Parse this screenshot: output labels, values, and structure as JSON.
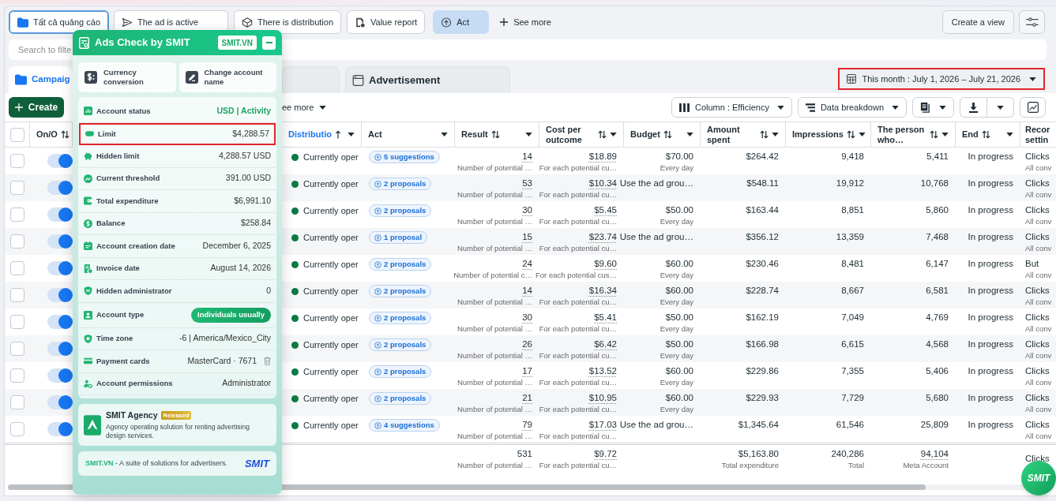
{
  "filter_chips": [
    {
      "label": "Tất cả quảng cáo",
      "selected": true,
      "pressed": false
    },
    {
      "label": "The ad is active",
      "selected": false,
      "pressed": false
    },
    {
      "label": "There is distribution",
      "selected": false,
      "pressed": false
    },
    {
      "label": "Value report",
      "selected": false,
      "pressed": false
    },
    {
      "label": "Act",
      "selected": false,
      "pressed": true
    }
  ],
  "see_more": "See more",
  "create_view": "Create a view",
  "search": {
    "placeholder": "Search to filte"
  },
  "level_tabs": [
    {
      "label": "Campaig",
      "selected": true
    },
    {
      "selected": false
    },
    {
      "label": "Advertisement",
      "selected": false
    }
  ],
  "date_range": {
    "label": "This month : July 1, 2026 – July 21, 2026",
    "highlighted": true
  },
  "toolbar": {
    "create": "Create",
    "more": "ee more",
    "columns": "Column : Efficiency",
    "breakdown": "Data breakdown"
  },
  "table": {
    "select_all": {
      "checked": false
    },
    "columns": [
      {
        "label": "On/O",
        "sortable": true,
        "sorted": false,
        "menu": false
      },
      {
        "label": "Distributio",
        "sortable": true,
        "sorted": true,
        "menu": true
      },
      {
        "label": "Act",
        "sortable": false,
        "sorted": false,
        "menu": true
      },
      {
        "label": "Result",
        "sortable": true,
        "sorted": false,
        "menu": true
      },
      {
        "label": "Cost per outcome",
        "sortable": true,
        "sorted": false,
        "menu": true
      },
      {
        "label": "Budget",
        "sortable": true,
        "sorted": false,
        "menu": true
      },
      {
        "label": "Amount spent",
        "sortable": true,
        "sorted": false,
        "menu": true
      },
      {
        "label": "Impressions",
        "sortable": true,
        "sorted": false,
        "menu": true
      },
      {
        "label": "The person who…",
        "sortable": true,
        "sorted": false,
        "menu": true
      },
      {
        "label": "End",
        "sortable": true,
        "sorted": false,
        "menu": true
      },
      {
        "label": "Recor settin",
        "sortable": false,
        "sorted": false,
        "menu": false
      }
    ],
    "rows": [
      {
        "checked": false,
        "on": true,
        "status": "Currently oper",
        "act": "5 suggestions",
        "result": "14",
        "result_note": "Number of potential …",
        "cost": "$18.89",
        "cost_note": "For each potential cu…",
        "budget": "$70.00",
        "budget_note": "Every day",
        "amount": "$264.42",
        "impressions": "9,418",
        "people": "5,411",
        "end": "In progress",
        "record": "Clicks",
        "record_note": "All conv"
      },
      {
        "checked": false,
        "on": true,
        "status": "Currently oper",
        "act": "2 proposals",
        "result": "53",
        "result_note": "Number of potential …",
        "cost": "$10.34",
        "cost_note": "For each potential cu…",
        "budget": "Use the ad grou…",
        "amount": "$548.11",
        "impressions": "19,912",
        "people": "10,768",
        "end": "In progress",
        "record": "Clicks",
        "record_note": "All conv"
      },
      {
        "checked": false,
        "on": true,
        "status": "Currently oper",
        "act": "2 proposals",
        "result": "30",
        "result_note": "Number of potential …",
        "cost": "$5.45",
        "cost_note": "For each potential cu…",
        "budget": "$50.00",
        "budget_note": "Every day",
        "amount": "$163.44",
        "impressions": "8,851",
        "people": "5,860",
        "end": "In progress",
        "record": "Clicks",
        "record_note": "All conv"
      },
      {
        "checked": false,
        "on": true,
        "status": "Currently oper",
        "act": "1 proposal",
        "result": "15",
        "result_note": "Number of potential …",
        "cost": "$23.74",
        "cost_note": "For each potential cu…",
        "budget": "Use the ad grou…",
        "amount": "$356.12",
        "impressions": "13,359",
        "people": "7,468",
        "end": "In progress",
        "record": "Clicks",
        "record_note": "All conv"
      },
      {
        "checked": false,
        "on": true,
        "status": "Currently oper",
        "act": "2 proposals",
        "result": "24",
        "result_note": "Number of potential c…",
        "cost": "$9.60",
        "cost_note": "For each potential cus…",
        "budget": "$60.00",
        "budget_note": "Every day",
        "amount": "$230.46",
        "impressions": "8,481",
        "people": "6,147",
        "end": "In progress",
        "record": "But",
        "record_note": "All conv"
      },
      {
        "checked": false,
        "on": true,
        "status": "Currently oper",
        "act": "2 proposals",
        "result": "14",
        "result_note": "Number of potential …",
        "cost": "$16.34",
        "cost_note": "For each potential cu…",
        "budget": "$60.00",
        "budget_note": "Every day",
        "amount": "$228.74",
        "impressions": "8,667",
        "people": "6,581",
        "end": "In progress",
        "record": "Clicks",
        "record_note": "All conv"
      },
      {
        "checked": false,
        "on": true,
        "status": "Currently oper",
        "act": "2 proposals",
        "result": "30",
        "result_note": "Number of potential …",
        "cost": "$5.41",
        "cost_note": "For each potential cu…",
        "budget": "$50.00",
        "budget_note": "Every day",
        "amount": "$162.19",
        "impressions": "7,049",
        "people": "4,769",
        "end": "In progress",
        "record": "Clicks",
        "record_note": "All conv"
      },
      {
        "checked": false,
        "on": true,
        "status": "Currently oper",
        "act": "2 proposals",
        "result": "26",
        "result_note": "Number of potential …",
        "cost": "$6.42",
        "cost_note": "For each potential cu…",
        "budget": "$50.00",
        "budget_note": "Every day",
        "amount": "$166.98",
        "impressions": "6,615",
        "people": "4,568",
        "end": "In progress",
        "record": "Clicks",
        "record_note": "All conv"
      },
      {
        "checked": false,
        "on": true,
        "status": "Currently oper",
        "act": "2 proposals",
        "result": "17",
        "result_note": "Number of potential …",
        "cost": "$13.52",
        "cost_note": "For each potential cu…",
        "budget": "$60.00",
        "budget_note": "Every day",
        "amount": "$229.86",
        "impressions": "7,355",
        "people": "5,406",
        "end": "In progress",
        "record": "Clicks",
        "record_note": "All conv"
      },
      {
        "checked": false,
        "on": true,
        "status": "Currently oper",
        "act": "2 proposals",
        "result": "21",
        "result_note": "Number of potential …",
        "cost": "$10.95",
        "cost_note": "For each potential cu…",
        "budget": "$60.00",
        "budget_note": "Every day",
        "amount": "$229.93",
        "impressions": "7,729",
        "people": "5,680",
        "end": "In progress",
        "record": "Clicks",
        "record_note": "All conv"
      },
      {
        "checked": false,
        "on": true,
        "status": "Currently oper",
        "act": "4 suggestions",
        "result": "79",
        "result_note": "Number of potential …",
        "cost": "$17.03",
        "cost_note": "For each potential cu…",
        "budget": "Use the ad grou…",
        "amount": "$1,345.64",
        "impressions": "61,546",
        "people": "25,809",
        "end": "In progress",
        "record": "Clicks",
        "record_note": "All conv"
      }
    ],
    "totals": {
      "result": "531",
      "result_note": "Number of potential …",
      "cost": "$9.72",
      "cost_note": "For each potential cu…",
      "amount": "$5,163.80",
      "amount_note": "Total expenditure",
      "impressions": "240,286",
      "impressions_note": "Total",
      "people": "94,104",
      "people_note": "Meta Account",
      "record": "Clicks"
    }
  },
  "panel": {
    "title": "Ads Check by SMIT",
    "link": "SMIT.VN",
    "actions": [
      "Currency conversion",
      "Change account name"
    ],
    "rows": [
      {
        "label": "Account status",
        "value": "USD | Activity",
        "kind": "status",
        "highlighted": false
      },
      {
        "label": "Limit",
        "value": "$4,288.57",
        "kind": "text",
        "highlighted": true
      },
      {
        "label": "Hidden limit",
        "value": "4,288.57 USD",
        "kind": "text",
        "highlighted": false
      },
      {
        "label": "Current threshold",
        "value": "391.00 USD",
        "kind": "text",
        "highlighted": false
      },
      {
        "label": "Total expenditure",
        "value": "$6,991.10",
        "kind": "text",
        "highlighted": false
      },
      {
        "label": "Balance",
        "value": "$258.84",
        "kind": "text",
        "highlighted": false
      },
      {
        "label": "Account creation date",
        "value": "December 6, 2025",
        "kind": "text",
        "highlighted": false
      },
      {
        "label": "Invoice date",
        "value": "August 14, 2026",
        "kind": "text",
        "highlighted": false
      },
      {
        "label": "Hidden administrator",
        "value": "0",
        "kind": "text",
        "highlighted": false
      },
      {
        "label": "Account type",
        "value": "Individuals usually",
        "kind": "pill",
        "highlighted": false
      },
      {
        "label": "Time zone",
        "value": "-6 | America/Mexico_City",
        "kind": "text",
        "highlighted": false
      },
      {
        "label": "Payment cards",
        "value": "MasterCard · 7671",
        "kind": "card",
        "highlighted": false
      },
      {
        "label": "Account permissions",
        "value": "Administrator",
        "kind": "text",
        "highlighted": false
      }
    ],
    "promo": {
      "title": "SMIT Agency",
      "badge": "Released",
      "text": "Agency operating solution for renting advertising design services."
    },
    "footer": {
      "brand": "SMIT.VN",
      "text": " - A suite of solutions for advertisers.",
      "logo": "SMIT"
    }
  },
  "fab": "SMIT"
}
